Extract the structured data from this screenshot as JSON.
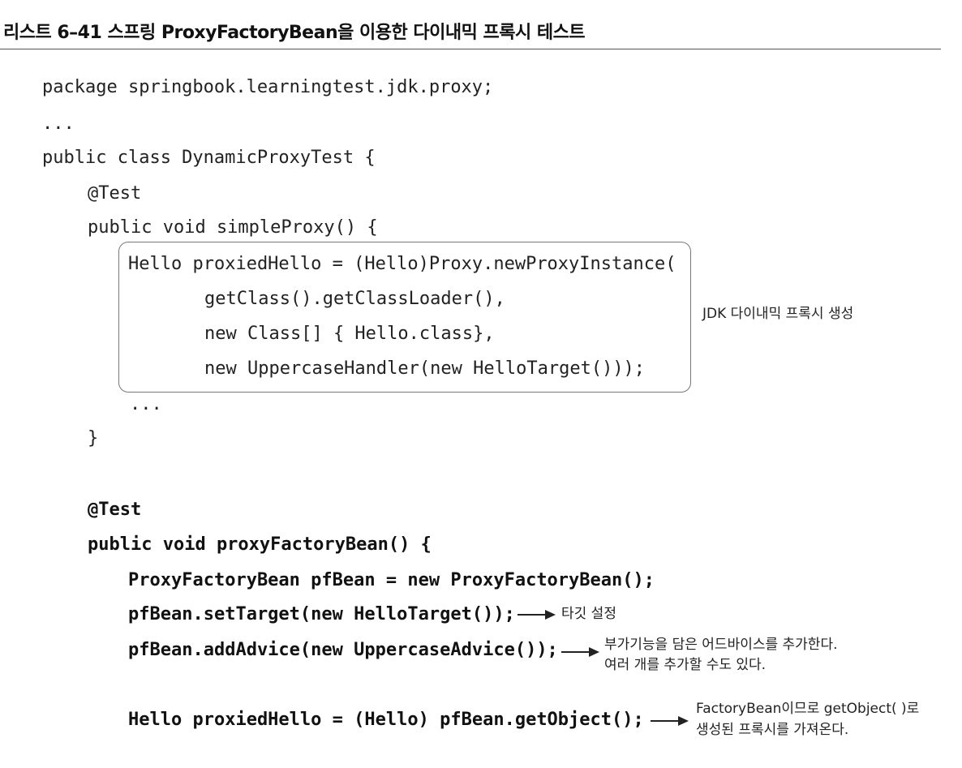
{
  "listing": {
    "title": "리스트 6–41 스프링 ProxyFactoryBean을 이용한 다이내믹 프록시 테스트"
  },
  "code": {
    "line1": "package springbook.learningtest.jdk.proxy;",
    "line2": "...",
    "line3": "public class DynamicProxyTest {",
    "line4": "@Test",
    "line5": "public void simpleProxy() {",
    "line6": "Hello proxiedHello = (Hello)Proxy.newProxyInstance(",
    "line7": "getClass().getClassLoader(),",
    "line8": "new Class[] { Hello.class},",
    "line9": "new UppercaseHandler(new HelloTarget()));",
    "line10": "...",
    "line11": "}",
    "line12": "@Test",
    "line13": "public void proxyFactoryBean() {",
    "line14": "ProxyFactoryBean pfBean = new ProxyFactoryBean();",
    "line15": "pfBean.setTarget(new HelloTarget());",
    "line16": "pfBean.addAdvice(new UppercaseAdvice());",
    "line17": "Hello proxiedHello = (Hello) pfBean.getObject();"
  },
  "annotations": {
    "jdk_proxy": "JDK 다이내믹 프록시 생성",
    "set_target": "타깃 설정",
    "add_advice_1": "부가기능을 담은 어드바이스를 추가한다.",
    "add_advice_2": "여러 개를 추가할 수도 있다.",
    "get_object_1": "FactoryBean이므로 getObject( )로",
    "get_object_2": "생성된 프록시를 가져온다."
  },
  "colors": {
    "text": "#1a1a1a",
    "rule": "#555555",
    "box_border": "#777777"
  }
}
